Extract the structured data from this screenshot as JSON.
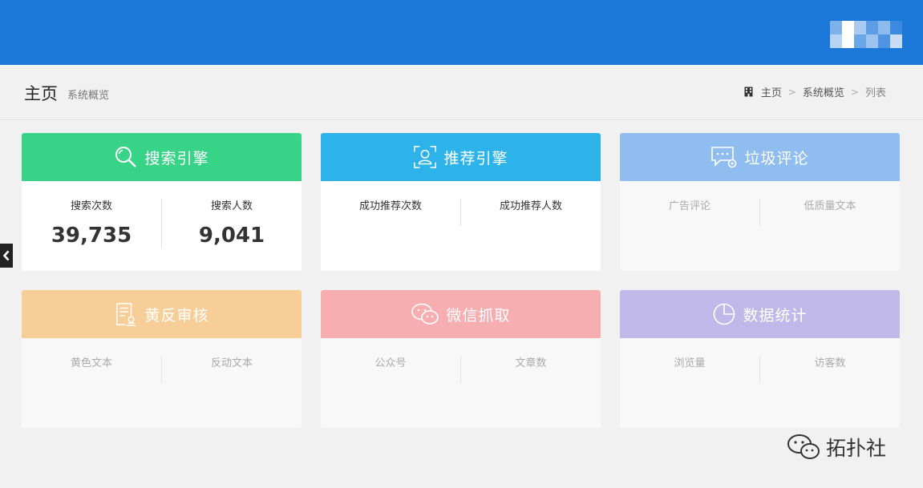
{
  "header": {
    "avatar": "blurred-avatar"
  },
  "page": {
    "title": "主页",
    "subtitle": "系统概览"
  },
  "breadcrumb": {
    "items": [
      "主页",
      "系统概览",
      "列表"
    ],
    "separator": ">"
  },
  "cards": [
    {
      "title": "搜索引擎",
      "color": "#37d386",
      "icon": "search-icon",
      "stats": [
        {
          "label": "搜索次数",
          "value": "39,735"
        },
        {
          "label": "搜索人数",
          "value": "9,041"
        }
      ]
    },
    {
      "title": "推荐引擎",
      "color": "#2db3ea",
      "icon": "user-recommend-icon",
      "stats": [
        {
          "label": "成功推荐次数",
          "value": ""
        },
        {
          "label": "成功推荐人数",
          "value": ""
        }
      ]
    },
    {
      "title": "垃圾评论",
      "color": "#8fbdf0",
      "icon": "comment-settings-icon",
      "stats": [
        {
          "label": "广告评论",
          "value": ""
        },
        {
          "label": "低质量文本",
          "value": ""
        }
      ]
    },
    {
      "title": "黄反审核",
      "color": "#f8ce98",
      "icon": "document-review-icon",
      "stats": [
        {
          "label": "黄色文本",
          "value": ""
        },
        {
          "label": "反动文本",
          "value": ""
        }
      ]
    },
    {
      "title": "微信抓取",
      "color": "#f7aeb0",
      "icon": "wechat-icon",
      "stats": [
        {
          "label": "公众号",
          "value": ""
        },
        {
          "label": "文章数",
          "value": ""
        }
      ]
    },
    {
      "title": "数据统计",
      "color": "#c0b8e8",
      "icon": "pie-chart-icon",
      "stats": [
        {
          "label": "浏览量",
          "value": ""
        },
        {
          "label": "访客数",
          "value": ""
        }
      ]
    }
  ],
  "watermark": {
    "text": "拓扑社"
  }
}
